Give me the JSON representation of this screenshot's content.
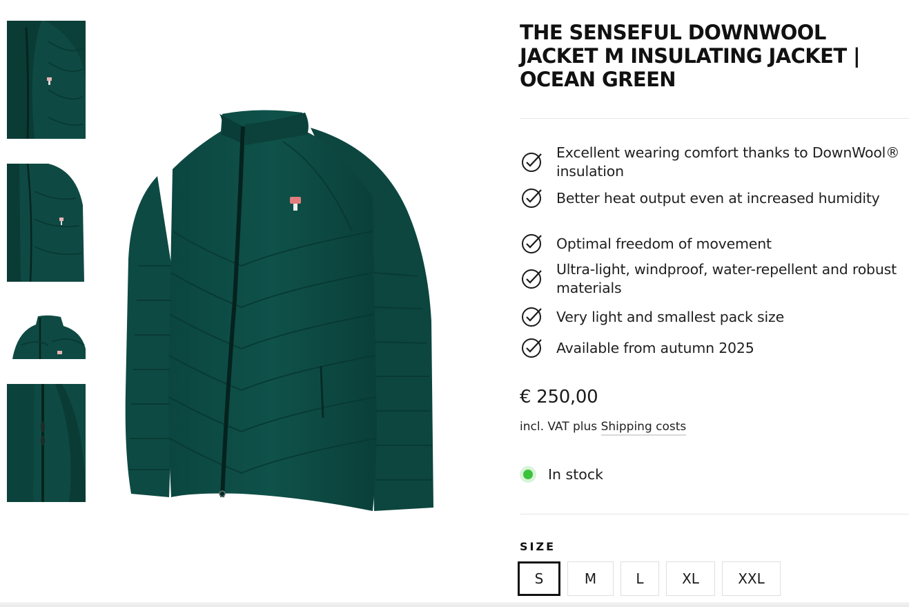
{
  "product": {
    "title": "THE SENSEFUL DOWNWOOL JACKET M INSULATING JACKET | OCEAN GREEN",
    "features": [
      "Excellent wearing comfort thanks to DownWool® insulation",
      "Better heat output even at increased humidity",
      "Optimal freedom of movement",
      "Ultra-light, windproof, water-repellent and robust materials",
      "Very light and smallest pack size",
      "Available from autumn 2025"
    ],
    "price": "€ 250,00",
    "vat_prefix": "incl. VAT plus ",
    "shipping_link": "Shipping costs",
    "stock_status": "In stock",
    "size_label": "SIZE",
    "sizes": [
      "S",
      "M",
      "L",
      "XL",
      "XXL"
    ],
    "selected_size": "S"
  },
  "colors": {
    "jacket": "#0d4a43",
    "in_stock": "#3cc23c"
  }
}
